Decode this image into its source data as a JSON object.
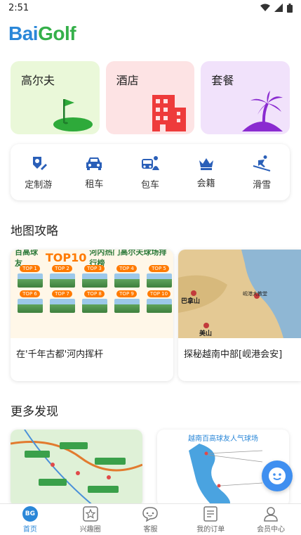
{
  "status": {
    "time": "2:51"
  },
  "logo": {
    "part1": "Bai",
    "part2": "Golf"
  },
  "categories": [
    {
      "label": "高尔夫",
      "icon": "golf-green-icon"
    },
    {
      "label": "酒店",
      "icon": "hotel-building-icon"
    },
    {
      "label": "套餐",
      "icon": "palm-island-icon"
    }
  ],
  "services": [
    {
      "label": "定制游",
      "icon": "map-pin-edit-icon"
    },
    {
      "label": "租车",
      "icon": "car-icon"
    },
    {
      "label": "包车",
      "icon": "van-driver-icon"
    },
    {
      "label": "会籍",
      "icon": "crown-icon"
    },
    {
      "label": "滑雪",
      "icon": "ski-icon"
    }
  ],
  "map_section": {
    "title": "地图攻略",
    "cards": [
      {
        "caption": "在'千年古都'河内挥杆",
        "thumb": {
          "brand": "百高球友",
          "top_label": "TOP10",
          "heading": "河内热门高尔夫球场排行榜",
          "ranks": [
            "TOP 1",
            "TOP 2",
            "TOP 3",
            "TOP 4",
            "TOP 5",
            "TOP 6",
            "TOP 7",
            "TOP 8",
            "TOP 9",
            "TOP 10"
          ]
        }
      },
      {
        "caption": "探秘越南中部[岘港会安]",
        "thumb": {
          "labels": [
            "巴拿山",
            "岘港大教堂",
            "美山"
          ]
        }
      }
    ]
  },
  "discover_section": {
    "title": "更多发现",
    "cards": [
      {
        "heading": ""
      },
      {
        "heading": "越南百高球友人气球场"
      }
    ]
  },
  "tabs": [
    {
      "label": "首页",
      "icon": "home-bg-icon",
      "active": true,
      "badge": "BG"
    },
    {
      "label": "兴趣圈",
      "icon": "star-square-icon"
    },
    {
      "label": "客服",
      "icon": "chat-bubble-icon"
    },
    {
      "label": "我的订单",
      "icon": "order-list-icon"
    },
    {
      "label": "会员中心",
      "icon": "user-icon"
    }
  ],
  "colors": {
    "brand_blue": "#2a87d8",
    "brand_green": "#35b04a",
    "accent_orange": "#ff7a00"
  }
}
